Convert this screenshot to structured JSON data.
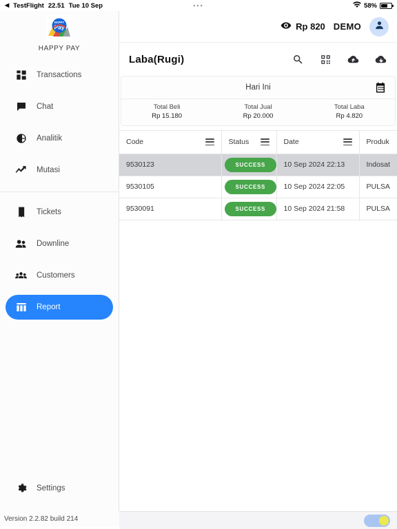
{
  "statusbar": {
    "back_app": "TestFlight",
    "back_arrow": "back-arrow-icon",
    "time": "22.51",
    "date": "Tue 10 Sep",
    "dots": "•••",
    "wifi_icon": "wifi-icon",
    "battery_percent": "58%",
    "battery_icon": "battery-icon"
  },
  "sidebar": {
    "brand": {
      "logo_icon": "happy-pay-logo",
      "name": "HAPPY PAY"
    },
    "items": [
      {
        "label": "Transactions",
        "icon": "dashboard-grid-icon",
        "active": false
      },
      {
        "label": "Chat",
        "icon": "chat-bubble-icon",
        "active": false
      },
      {
        "label": "Analitik",
        "icon": "pie-chart-icon",
        "active": false
      },
      {
        "label": "Mutasi",
        "icon": "trend-up-icon",
        "active": false
      },
      {
        "label": "Tickets",
        "icon": "receipt-icon",
        "active": false
      },
      {
        "label": "Downline",
        "icon": "people-icon",
        "active": false
      },
      {
        "label": "Customers",
        "icon": "group-icon",
        "active": false
      },
      {
        "label": "Report",
        "icon": "report-columns-icon",
        "active": true
      }
    ],
    "settings": {
      "label": "Settings",
      "icon": "gear-icon"
    },
    "version": "Version 2.2.82 build 214"
  },
  "topbar": {
    "eye_icon": "eye-icon",
    "balance": "Rp 820",
    "account_label": "DEMO",
    "avatar_icon": "person-avatar-icon"
  },
  "page": {
    "title": "Laba(Rugi)",
    "actions": [
      {
        "name": "search-icon",
        "label": "search"
      },
      {
        "name": "qr-code-icon",
        "label": "qr code"
      },
      {
        "name": "cloud-upload-icon",
        "label": "cloud upload"
      },
      {
        "name": "cloud-download-icon",
        "label": "cloud download"
      }
    ]
  },
  "summary": {
    "period_label": "Hari Ini",
    "calendar_icon": "calendar-icon",
    "totals": [
      {
        "label": "Total Beli",
        "value": "Rp 15.180"
      },
      {
        "label": "Total Jual",
        "value": "Rp 20.000"
      },
      {
        "label": "Total Laba",
        "value": "Rp 4.820"
      }
    ]
  },
  "table": {
    "columns": [
      {
        "label": "Code",
        "menu_icon": "column-menu-icon"
      },
      {
        "label": "Status",
        "menu_icon": "column-menu-icon"
      },
      {
        "label": "Date",
        "menu_icon": "column-menu-icon"
      },
      {
        "label": "Produk",
        "menu_icon": "column-menu-icon"
      }
    ],
    "rows": [
      {
        "code": "9530123",
        "status": "SUCCESS",
        "date": "10 Sep 2024 22:13",
        "product": "Indosat",
        "selected": true
      },
      {
        "code": "9530105",
        "status": "SUCCESS",
        "date": "10 Sep 2024 22:05",
        "product": "PULSA",
        "selected": false
      },
      {
        "code": "9530091",
        "status": "SUCCESS",
        "date": "10 Sep 2024 21:58",
        "product": "PULSA",
        "selected": false
      }
    ]
  },
  "bottombar": {
    "toggle_name": "theme-toggle",
    "toggle_state": "on"
  },
  "colors": {
    "accent": "#2684FC",
    "success": "#47a54a",
    "selected_row": "#d3d4d8",
    "avatar_bg": "#cfe0fb",
    "toggle_track": "#aac5f2",
    "toggle_knob": "#ece84f"
  }
}
